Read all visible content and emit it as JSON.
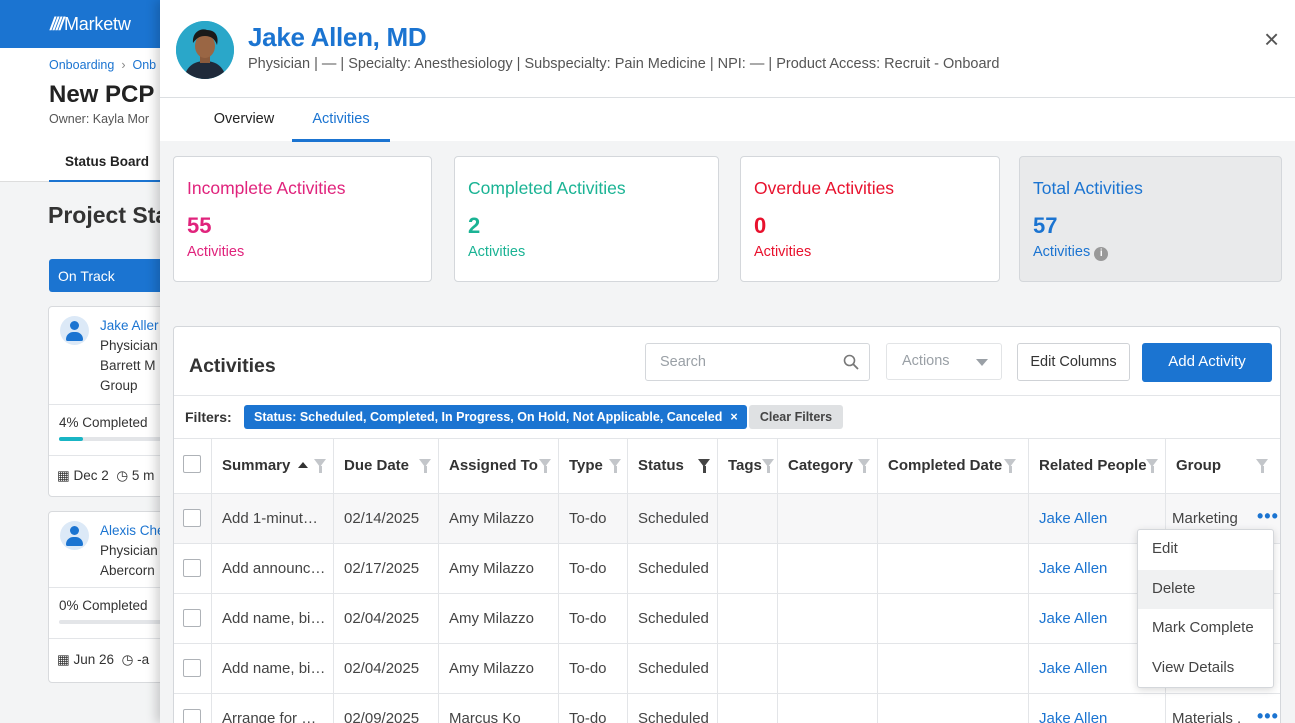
{
  "bg": {
    "logo": "Marketw",
    "breadcrumb": [
      "Onboarding",
      "Onb"
    ],
    "title": "New PCP I",
    "owner": "Owner: Kayla Mor",
    "tab": "Status Board",
    "section_title": "Project Sta",
    "status_button": "On Track",
    "cards": [
      {
        "name": "Jake Aller",
        "lines": [
          "Physician",
          "Barrett M",
          "Group"
        ],
        "progress": "4% Completed",
        "progress_value": 0.04,
        "date": "Dec 2",
        "time": "5 m"
      },
      {
        "name": "Alexis Che",
        "lines": [
          "Physician",
          "Abercorn"
        ],
        "progress": "0% Completed",
        "progress_value": 0.0,
        "date": "Jun 26",
        "time": "-a"
      }
    ]
  },
  "header": {
    "name": "Jake Allen, MD",
    "meta": "Physician | — | Specialty: Anesthesiology | Subspecialty: Pain Medicine | NPI: — | Product Access: Recruit - Onboard",
    "close": "×"
  },
  "tabs": {
    "overview": "Overview",
    "activities": "Activities"
  },
  "stats": {
    "incomplete": {
      "label": "Incomplete Activities",
      "value": "55",
      "unit": "Activities",
      "color": "#e0237c"
    },
    "completed": {
      "label": "Completed Activities",
      "value": "2",
      "unit": "Activities",
      "color": "#1ab394"
    },
    "overdue": {
      "label": "Overdue Activities",
      "value": "0",
      "unit": "Activities",
      "color": "#e8112d"
    },
    "total": {
      "label": "Total Activities",
      "value": "57",
      "unit": "Activities",
      "color": "#1b74d1"
    }
  },
  "panel": {
    "title": "Activities",
    "search_placeholder": "Search",
    "actions_label": "Actions",
    "edit_columns": "Edit Columns",
    "add_activity": "Add Activity",
    "filters_label": "Filters:",
    "filter_chip": "Status: Scheduled, Completed, In Progress, On Hold, Not Applicable, Canceled",
    "clear_filters": "Clear Filters"
  },
  "table": {
    "columns": [
      "Summary",
      "Due Date",
      "Assigned To",
      "Type",
      "Status",
      "Tags",
      "Category",
      "Completed Date",
      "Related People",
      "Group"
    ],
    "rows": [
      {
        "summary": "Add 1-minut…",
        "due": "02/14/2025",
        "assigned": "Amy Milazzo",
        "type": "To-do",
        "status": "Scheduled",
        "tags": "",
        "category": "",
        "completed": "",
        "related": "Jake Allen",
        "group": "Marketing"
      },
      {
        "summary": "Add announc…",
        "due": "02/17/2025",
        "assigned": "Amy Milazzo",
        "type": "To-do",
        "status": "Scheduled",
        "tags": "",
        "category": "",
        "completed": "",
        "related": "Jake Allen",
        "group": ""
      },
      {
        "summary": "Add name, bi…",
        "due": "02/04/2025",
        "assigned": "Amy Milazzo",
        "type": "To-do",
        "status": "Scheduled",
        "tags": "",
        "category": "",
        "completed": "",
        "related": "Jake Allen",
        "group": ""
      },
      {
        "summary": "Add name, bi…",
        "due": "02/04/2025",
        "assigned": "Amy Milazzo",
        "type": "To-do",
        "status": "Scheduled",
        "tags": "",
        "category": "",
        "completed": "",
        "related": "Jake Allen",
        "group": ""
      },
      {
        "summary": "Arrange for …",
        "due": "02/09/2025",
        "assigned": "Marcus Ko",
        "type": "To-do",
        "status": "Scheduled",
        "tags": "",
        "category": "",
        "completed": "",
        "related": "Jake Allen",
        "group": "Materials ."
      }
    ]
  },
  "context_menu": [
    "Edit",
    "Delete",
    "Mark Complete",
    "View Details"
  ]
}
